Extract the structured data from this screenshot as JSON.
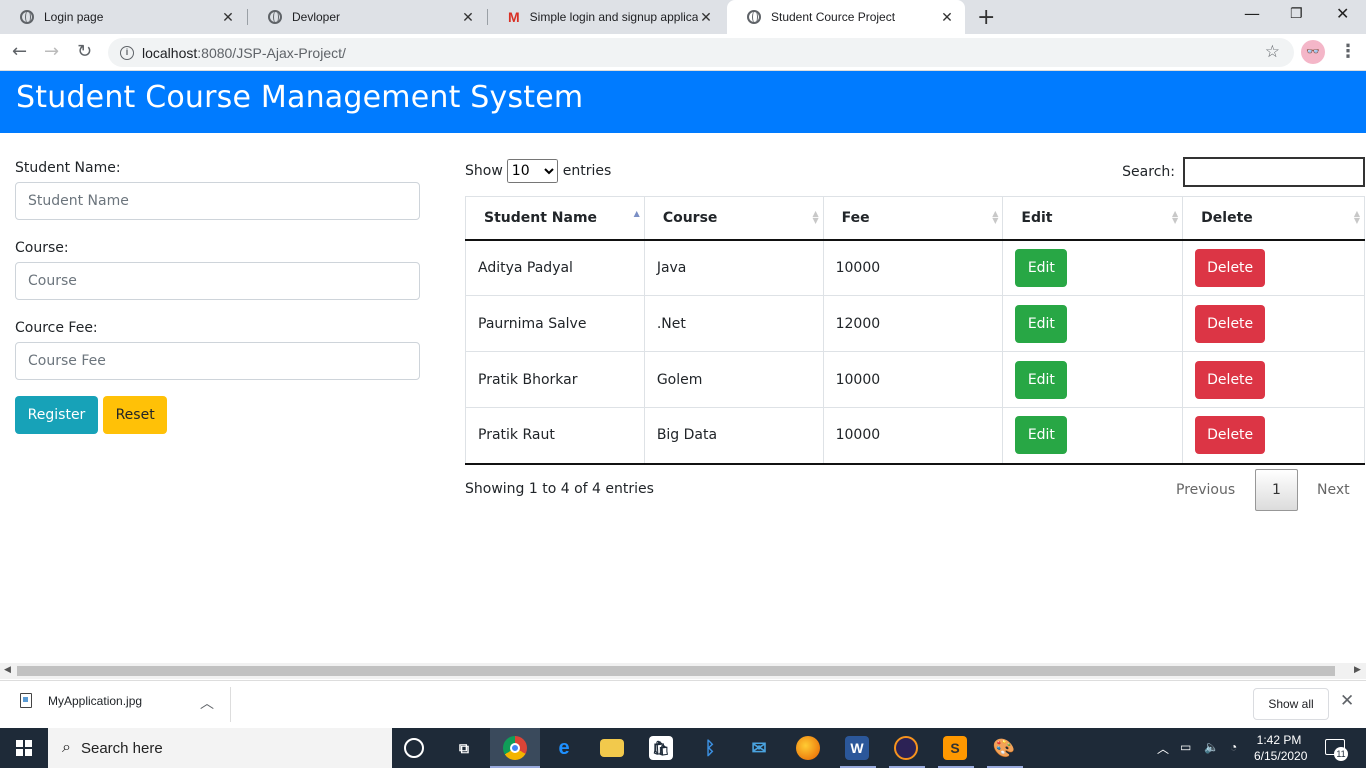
{
  "browser": {
    "tabs": [
      {
        "title": "Login page",
        "icon": "globe-icon"
      },
      {
        "title": "Devloper",
        "icon": "globe-icon"
      },
      {
        "title": "Simple login and signup applicati",
        "icon": "gmail-icon"
      },
      {
        "title": "Student Cource Project",
        "icon": "globe-icon"
      }
    ],
    "active_tab": 3,
    "url_host": "localhost",
    "url_rest": ":8080/JSP-Ajax-Project/"
  },
  "page": {
    "title": "Student Course Management System",
    "accent_color": "#007bff"
  },
  "form": {
    "student_name_label": "Student Name:",
    "student_name_placeholder": "Student Name",
    "course_label": "Course:",
    "course_placeholder": "Course",
    "fee_label": "Cource Fee:",
    "fee_placeholder": "Course Fee",
    "register_label": "Register",
    "reset_label": "Reset"
  },
  "datatable": {
    "show_label": "Show",
    "entries_label": "entries",
    "page_length": "10",
    "search_label": "Search:",
    "columns": [
      "Student Name",
      "Course",
      "Fee",
      "Edit",
      "Delete"
    ],
    "sorted_column": "Student Name",
    "rows": [
      {
        "name": "Aditya Padyal",
        "course": "Java",
        "fee": "10000",
        "edit": "Edit",
        "delete": "Delete"
      },
      {
        "name": "Paurnima Salve",
        "course": ".Net",
        "fee": "12000",
        "edit": "Edit",
        "delete": "Delete"
      },
      {
        "name": "Pratik Bhorkar",
        "course": "Golem",
        "fee": "10000",
        "edit": "Edit",
        "delete": "Delete"
      },
      {
        "name": "Pratik Raut",
        "course": "Big Data",
        "fee": "10000",
        "edit": "Edit",
        "delete": "Delete"
      }
    ],
    "info": "Showing 1 to 4 of 4 entries",
    "previous_label": "Previous",
    "current_page": "1",
    "next_label": "Next"
  },
  "downloads": {
    "file_name": "MyApplication.jpg",
    "show_all_label": "Show all"
  },
  "taskbar": {
    "search_placeholder": "Search here",
    "time": "1:42 PM",
    "date": "6/15/2020",
    "notification_count": "11"
  }
}
